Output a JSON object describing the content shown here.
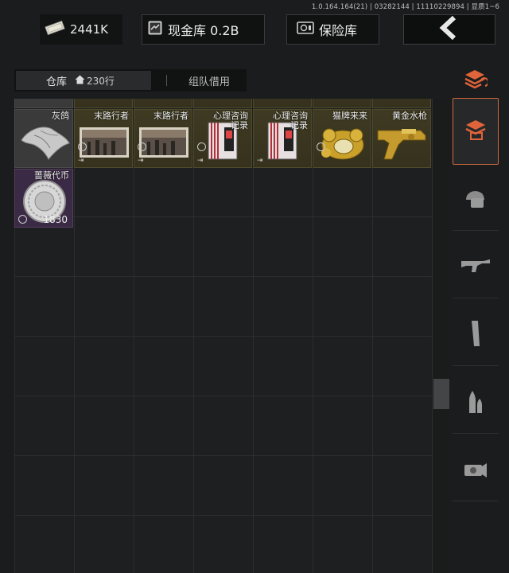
{
  "version": "1.0.164.164(21) | 03282144 | 11110229894 | 显质1~6",
  "currency": {
    "value": "2441K",
    "icon": "banknote-icon"
  },
  "cash_vault": {
    "label": "现金库 0.2B",
    "icon": "cash-vault-icon"
  },
  "safe_vault": {
    "label": "保险库",
    "icon": "safe-icon"
  },
  "back": {
    "icon": "back-arrow-icon"
  },
  "tabs": {
    "warehouse": "仓库",
    "rows": "230行",
    "team_borrow": "组队借用"
  },
  "items": [
    {
      "name": "灰鸽",
      "icon": "grey-pigeon-icon",
      "rarity": "gray"
    },
    {
      "name": "末路行者",
      "icon": "poster-icon",
      "rarity": "gold"
    },
    {
      "name": "末路行者",
      "icon": "poster-icon",
      "rarity": "gold"
    },
    {
      "name": "心理咨询\n记录",
      "icon": "tape-icon",
      "rarity": "gold"
    },
    {
      "name": "心理咨询\n记录",
      "icon": "tape-icon",
      "rarity": "gold"
    },
    {
      "name": "猫牌来来",
      "icon": "gold-cat-icon",
      "rarity": "gold"
    },
    {
      "name": "黄金水枪",
      "icon": "gold-water-gun-icon",
      "rarity": "gold"
    },
    {
      "name": "蔷薇代币",
      "icon": "rose-coin-icon",
      "rarity": "purple",
      "quantity": "1830"
    }
  ],
  "sidebar": {
    "items": [
      {
        "name": "sort",
        "icon": "sort-stack-icon"
      },
      {
        "name": "all",
        "icon": "layer-box-icon"
      },
      {
        "name": "gear",
        "icon": "helmet-vest-icon"
      },
      {
        "name": "weapons",
        "icon": "rifle-icon"
      },
      {
        "name": "magazines",
        "icon": "magazine-icon"
      },
      {
        "name": "ammo",
        "icon": "ammo-icon"
      },
      {
        "name": "attachments",
        "icon": "scope-icon"
      }
    ]
  },
  "colors": {
    "accent": "#d26a3d",
    "gold_cell": "#3e3a22",
    "purple_cell": "#3b2a45"
  }
}
